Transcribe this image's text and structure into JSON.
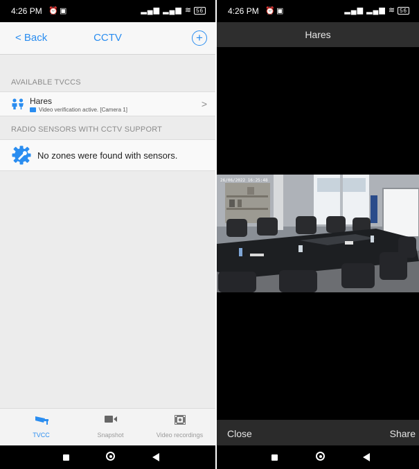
{
  "statusbar": {
    "time": "4:26 PM",
    "battery": "56"
  },
  "left": {
    "back_label": "< Back",
    "title": "CCTV",
    "add_icon": "plus-circle-icon",
    "section_tvccs": "AVAILABLE TVCCS",
    "tvcc_item": {
      "name": "Hares",
      "subtitle": "Video verification active. [Camera 1]"
    },
    "section_radio": "RADIO SENSORS WITH CCTV SUPPORT",
    "no_zones_text": "No zones were found with sensors.",
    "tabs": [
      {
        "label": "TVCC",
        "icon": "cctv-camera-icon",
        "active": true
      },
      {
        "label": "Snapshot",
        "icon": "video-camera-icon",
        "active": false
      },
      {
        "label": "Video recordings",
        "icon": "film-icon",
        "active": false
      }
    ]
  },
  "right": {
    "title": "Hares",
    "timestamp": "26/06/2022 16:25:48",
    "close_label": "Close",
    "share_label": "Share"
  },
  "colors": {
    "accent": "#2a8df0",
    "inactive_tab": "#9a9a9a"
  }
}
